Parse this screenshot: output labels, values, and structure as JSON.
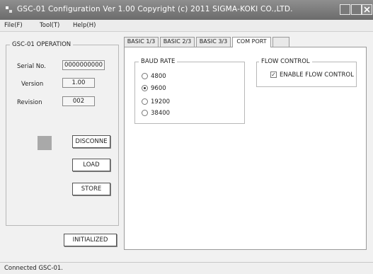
{
  "window": {
    "title": "GSC-01 Configuration  Ver 1.00  Copyright (c) 2011  SIGMA-KOKI CO.,LTD."
  },
  "menu": [
    "File(F)",
    "Tool(T)",
    "Help(H)"
  ],
  "operation": {
    "group_label": "GSC-01 OPERATION",
    "serial_label": "Serial No.",
    "serial_value": "0000000000",
    "version_label": "Version",
    "version_value": "1.00",
    "revision_label": "Revision",
    "revision_value": "002",
    "disconnect_label": "DISCONNE",
    "load_label": "LOAD",
    "store_label": "STORE",
    "indicator_color": "#a9a9a9"
  },
  "initialized_label": "INITIALIZED",
  "tabs": [
    "BASIC 1/3",
    "BASIC 2/3",
    "BASIC 3/3",
    "COM PORT"
  ],
  "active_tab": "COM PORT",
  "baud": {
    "label": "BAUD RATE",
    "options": [
      "4800",
      "9600",
      "19200",
      "38400"
    ],
    "selected": "9600"
  },
  "flow": {
    "label": "FLOW CONTROL",
    "checkbox_label": "ENABLE FLOW CONTROL",
    "checked": true
  },
  "status": {
    "text": "Connected GSC-01."
  }
}
